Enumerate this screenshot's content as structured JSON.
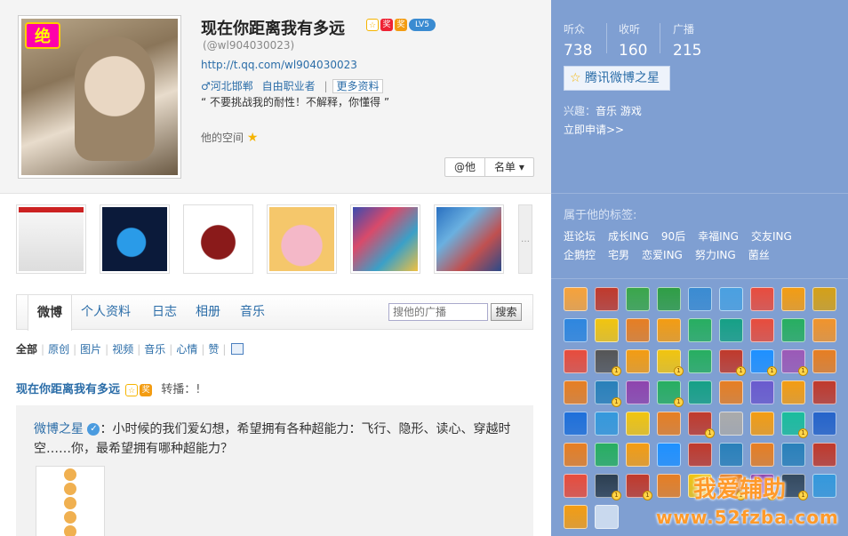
{
  "profile": {
    "name": "现在你距离我有多远",
    "uid": "(@wl904030023)",
    "url": "http://t.qq.com/wl904030023",
    "location": "♂河北邯郸",
    "occupation": "自由职业者",
    "more_info": "更多资料",
    "motto": "“ 不要挑战我的耐性！不解释，你懂得 ”",
    "space": "他的空间",
    "avatar_badge": "绝",
    "icons": [
      "star-badge-icon",
      "lottery-badge-icon",
      "award-badge-icon",
      "level-badge-icon"
    ],
    "icon_labels": [
      "☆",
      "奖",
      "奖",
      "LV5"
    ],
    "btn_him": "@他",
    "btn_list": "名单 ▾"
  },
  "stats": [
    {
      "label": "听众",
      "value": "738"
    },
    {
      "label": "收听",
      "value": "160"
    },
    {
      "label": "广播",
      "value": "215"
    }
  ],
  "sidebar": {
    "star_button": "腾讯微博之星",
    "interests_label": "兴趣：",
    "interests": "音乐 游戏",
    "apply": "立即申请>>",
    "tags_title": "属于他的标签:",
    "tags": [
      "逛论坛",
      "成长ING",
      "90后",
      "幸福ING",
      "交友ING",
      "企鹅控",
      "宅男",
      "恋爱ING",
      "努力ING",
      "菌丝"
    ]
  },
  "tabs": [
    "微博",
    "个人资料",
    "日志",
    "相册",
    "音乐"
  ],
  "search": {
    "placeholder": "搜他的广播",
    "button": "搜索"
  },
  "filters": [
    "全部",
    "原创",
    "图片",
    "视频",
    "音乐",
    "心情",
    "赞"
  ],
  "post": {
    "author": "现在你距离我有多远",
    "action": "转播：!",
    "quote_author": "微博之星",
    "quote_text": "：小时候的我们爱幻想，希望拥有各种超能力：飞行、隐形、读心、穿越时空……你，最希望拥有哪种超能力？"
  },
  "badge_colors": [
    "#f6a23a",
    "#c0392b",
    "#3aa64a",
    "#2f9e44",
    "#3a8bd1",
    "#4aa0e0",
    "#e84c3d",
    "#f39c12",
    "#d4a017",
    "#2e86de",
    "#f1c40f",
    "#e67e22",
    "#f39c12",
    "#27ae60",
    "#16a085",
    "#e74c3c",
    "#27ae60",
    "#f0932b",
    "#e74c3c",
    "#555555",
    "#f39c12",
    "#f1c40f",
    "#27ae60",
    "#c0392b",
    "#1e90ff",
    "#9b59b6",
    "#e67e22",
    "#e67e22",
    "#2980b9",
    "#8e44ad",
    "#27ae60",
    "#16a085",
    "#e67e22",
    "#6a5acd",
    "#f39c12",
    "#c0392b",
    "#1e6fd9",
    "#3498db",
    "#f1c40f",
    "#e67e22",
    "#c0392b",
    "#aaaaaa",
    "#f39c12",
    "#1abc9c",
    "#2563c9",
    "#e67e22",
    "#27ae60",
    "#f39c12",
    "#1e90ff",
    "#c0392b",
    "#2980b9",
    "#e67e22",
    "#2980b9",
    "#c0392b",
    "#e74c3c",
    "#2c3e50",
    "#c0392b",
    "#e67e22",
    "#f1c40f",
    "#e67e22",
    "#8e44ad",
    "#34495e",
    "#3498db",
    "#f39c12",
    "#8e6a3d",
    "#8e6a3d",
    "#c0392b",
    "#e67e22",
    "#e67e22",
    "#e74c3c",
    "#e67e22",
    "#3498db"
  ],
  "watermark": {
    "line1": "我爱辅助",
    "line2": "www.52fzba.com"
  }
}
